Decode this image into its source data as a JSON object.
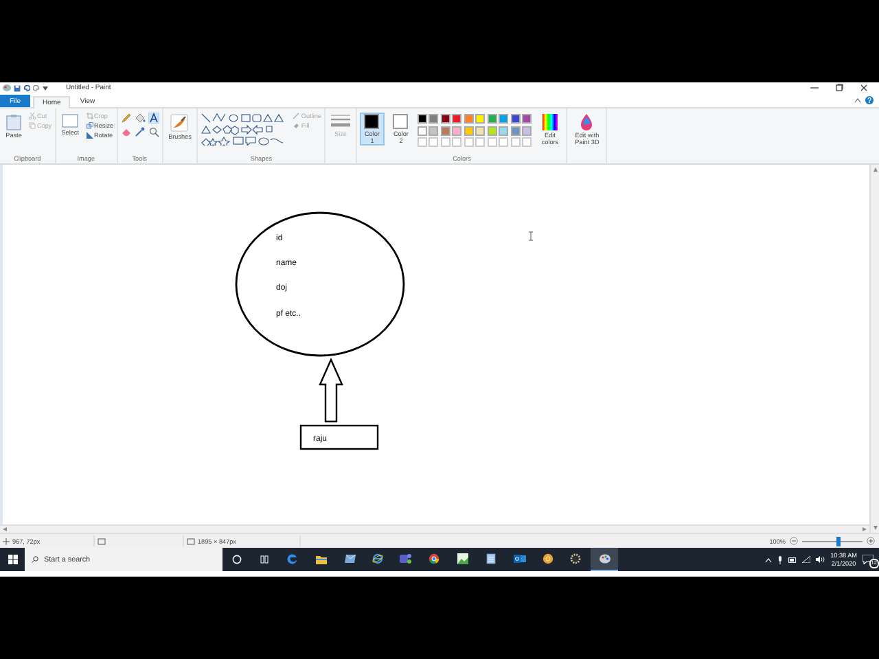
{
  "window": {
    "title": "Untitled - Paint"
  },
  "menu_tabs": [
    {
      "label": "File",
      "kind": "file",
      "selected": false
    },
    {
      "label": "Home",
      "kind": "tab",
      "selected": true
    },
    {
      "label": "View",
      "kind": "tab",
      "selected": false
    }
  ],
  "ribbon": [
    {
      "kind": "clipboard",
      "label": "Clipboard",
      "buttons": [
        {
          "label": "Paste",
          "disabled": false
        },
        {
          "label": "Cut",
          "disabled": true
        },
        {
          "label": "Copy",
          "disabled": true
        }
      ]
    },
    {
      "kind": "image",
      "label": "Image",
      "buttons": [
        {
          "label": "Select",
          "disabled": false
        },
        {
          "label": "Crop",
          "disabled": true
        },
        {
          "label": "Resize",
          "disabled": false
        },
        {
          "label": "Rotate",
          "disabled": false
        }
      ]
    },
    {
      "kind": "tools",
      "label": "Tools"
    },
    {
      "kind": "brushes",
      "buttons": [
        {
          "label": "Brushes",
          "disabled": false
        }
      ]
    },
    {
      "kind": "shapes",
      "label": "Shapes",
      "buttons": [
        {
          "label": "Outline",
          "disabled": true
        },
        {
          "label": "Fill",
          "disabled": true
        }
      ]
    },
    {
      "kind": "size",
      "buttons": [
        {
          "label": "Size",
          "disabled": true
        }
      ]
    },
    {
      "kind": "colors",
      "label": "Colors",
      "color_buttons": [
        {
          "label": "Color 1",
          "selected": true
        },
        {
          "label": "Color 2",
          "selected": false
        }
      ],
      "palette": [
        {
          "color": "#000000"
        },
        {
          "color": "#7f7f7f"
        },
        {
          "color": "#880015"
        },
        {
          "color": "#ed1c24"
        },
        {
          "color": "#ff7f27"
        },
        {
          "color": "#fff200"
        },
        {
          "color": "#22b14c"
        },
        {
          "color": "#00a2e8"
        },
        {
          "color": "#3f48cc"
        },
        {
          "color": "#a349a4"
        },
        {
          "color": "#ffffff"
        },
        {
          "color": "#c3c3c3"
        },
        {
          "color": "#b97a57"
        },
        {
          "color": "#ffaec9"
        },
        {
          "color": "#ffc90e"
        },
        {
          "color": "#efe4b0"
        },
        {
          "color": "#b5e61d"
        },
        {
          "color": "#99d9ea"
        },
        {
          "color": "#7092be"
        },
        {
          "color": "#c8bfe7"
        }
      ],
      "edit_label": "Edit colors"
    },
    {
      "kind": "paint3d",
      "buttons": [
        {
          "label": "Edit with Paint 3D",
          "disabled": false
        }
      ]
    }
  ],
  "canvas": {
    "ellipse_lines": [
      "id",
      "name",
      "doj",
      "pf etc.."
    ],
    "box_label": "raju"
  },
  "status_bar": {
    "cursor_position": "967, 72px",
    "image_size": "1895 × 847px",
    "zoom": "100%",
    "zoom_slider": {
      "level": 0.6
    }
  },
  "taskbar": {
    "search_placeholder": "Start a search",
    "apps": [
      {
        "kind": "cortana",
        "selected": false
      },
      {
        "kind": "taskview",
        "selected": false
      },
      {
        "kind": "edge",
        "selected": false
      },
      {
        "kind": "folder",
        "selected": false
      },
      {
        "kind": "mail",
        "selected": false
      },
      {
        "kind": "ie",
        "selected": false
      },
      {
        "kind": "teams",
        "selected": false
      },
      {
        "kind": "chrome",
        "selected": false
      },
      {
        "kind": "photos",
        "selected": false
      },
      {
        "kind": "notepad",
        "selected": false
      },
      {
        "kind": "outlook",
        "selected": false
      },
      {
        "kind": "orange",
        "selected": false
      },
      {
        "kind": "gear",
        "selected": false
      },
      {
        "kind": "paint",
        "selected": true
      }
    ],
    "time": "10:38 AM",
    "date": "2/1/2020",
    "notifications": "12"
  }
}
